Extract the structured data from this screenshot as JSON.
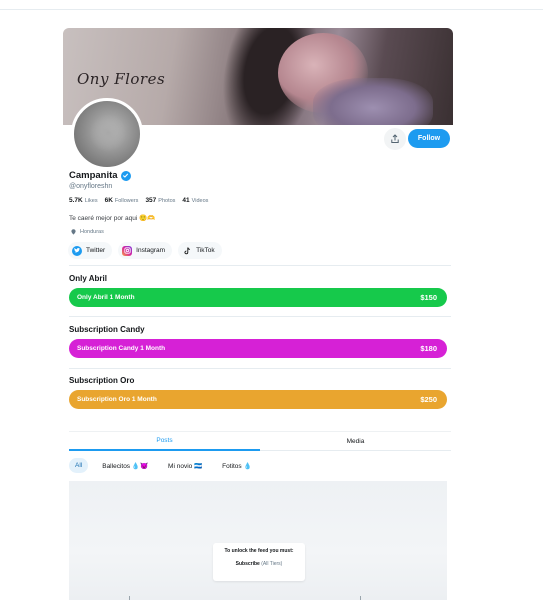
{
  "banner": {
    "signature": "Ony Flores"
  },
  "profile": {
    "name": "Campanita",
    "handle": "@onyfloreshn",
    "stats": [
      {
        "value": "5.7K",
        "label": "Likes"
      },
      {
        "value": "6K",
        "label": "Followers"
      },
      {
        "value": "357",
        "label": "Photos"
      },
      {
        "value": "41",
        "label": "Videos"
      }
    ],
    "bio": "Te caeré mejor por aqui 🙂🫶",
    "location": "Honduras"
  },
  "actions": {
    "follow_label": "Follow"
  },
  "socials": [
    {
      "label": "Twitter",
      "color": "#1d9bf0"
    },
    {
      "label": "Instagram",
      "color": "#d6249f"
    },
    {
      "label": "TikTok",
      "color": "#111111"
    }
  ],
  "subscriptions": [
    {
      "title": "Only Abril",
      "plan": "Only Abril 1 Month",
      "price": "$150",
      "color": "#16c94b"
    },
    {
      "title": "Subscription Candy",
      "plan": "Subscription Candy 1 Month",
      "price": "$180",
      "color": "#d621d6"
    },
    {
      "title": "Subscription Oro",
      "plan": "Subscription Oro 1 Month",
      "price": "$250",
      "color": "#e9a52f"
    }
  ],
  "tabs": {
    "posts": "Posts",
    "media": "Media"
  },
  "filters": [
    "All",
    "Ballecitos 💧😈",
    "Mi novio 🇭🇳",
    "Fotitos 💧"
  ],
  "locked": {
    "message": "To unlock the feed you must:",
    "action": "Subscribe",
    "tiers": "(All Tiers)"
  }
}
